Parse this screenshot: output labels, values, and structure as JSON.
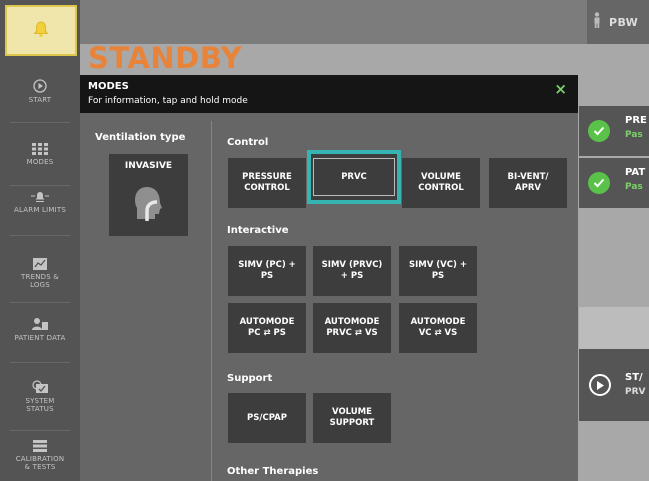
{
  "colors": {
    "accent_orange": "#e8843a",
    "selected_outline": "#35b4b2",
    "ok_green": "#5ac249",
    "alarm_yellow": "#f3cf3a"
  },
  "topbar": {
    "pbw_label": "PBW"
  },
  "status_title": "STANDBY",
  "sidebar": {
    "items": [
      {
        "label": "START",
        "icon": "play-icon"
      },
      {
        "label": "MODES",
        "icon": "modes-grid-icon"
      },
      {
        "label": "ALARM LIMITS",
        "icon": "alarm-limits-icon"
      },
      {
        "label": "TRENDS &\nLOGS",
        "icon": "trends-icon"
      },
      {
        "label": "PATIENT DATA",
        "icon": "patient-data-icon"
      },
      {
        "label": "SYSTEM\nSTATUS",
        "icon": "system-status-icon"
      },
      {
        "label": "CALIBRATION\n& TESTS",
        "icon": "calibration-icon"
      }
    ]
  },
  "modes_panel": {
    "title": "MODES",
    "subtitle": "For information, tap and hold mode",
    "close_icon": "×",
    "ventilation_type_label": "Ventilation type",
    "ventilation_type_value": "INVASIVE",
    "sections": {
      "control": "Control",
      "interactive": "Interactive",
      "support": "Support",
      "other": "Other Therapies"
    },
    "buttons": {
      "pressure_control": "PRESSURE\nCONTROL",
      "prvc": "PRVC",
      "volume_control": "VOLUME\nCONTROL",
      "bivent_aprv": "BI-VENT/\nAPRV",
      "simv_pc_ps": "SIMV (PC) +\nPS",
      "simv_prvc_ps": "SIMV (PRVC)\n+ PS",
      "simv_vc_ps": "SIMV (VC) +\nPS",
      "automode_pc_ps": "AUTOMODE\nPC ⇄ PS",
      "automode_prvc_vs": "AUTOMODE\nPRVC ⇄ VS",
      "automode_vc_vs": "AUTOMODE\nVC ⇄ VS",
      "ps_cpap": "PS/CPAP",
      "volume_support": "VOLUME\nSUPPORT"
    },
    "selected_mode": "PRVC"
  },
  "right_cards": {
    "card1": {
      "title": "PRE",
      "status": "Pas"
    },
    "card2": {
      "title": "PAT",
      "status": "Pas"
    },
    "card3": {
      "title": "ST/",
      "subtitle": "PRV"
    }
  }
}
